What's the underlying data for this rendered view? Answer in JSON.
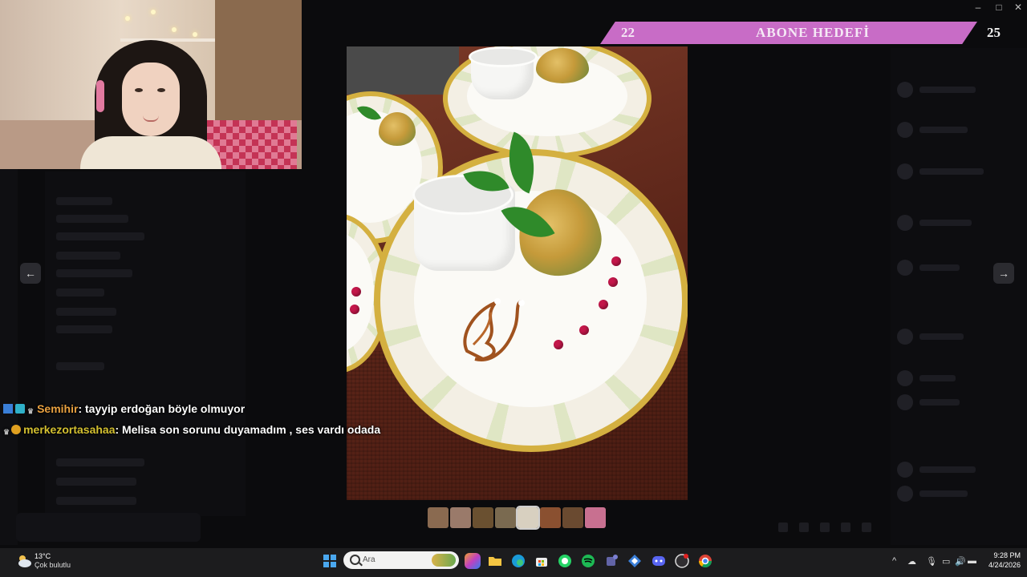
{
  "window": {
    "title": "Discord"
  },
  "goal": {
    "current": "22",
    "title": "ABONE HEDEFİ",
    "target": "25"
  },
  "chat": [
    {
      "user": "Semihir",
      "message": ": tayyip erdoğan böyle olmuyor"
    },
    {
      "user": "merkezortasahaa",
      "message": ": Melisa son sorunu duyamadım , ses vardı odada"
    }
  ],
  "viewer": {
    "prev_icon": "arrow-left-icon",
    "next_icon": "arrow-right-icon",
    "thumbnail_count": 8,
    "selected_thumbnail": 5
  },
  "taskbar": {
    "weather_temp": "13°C",
    "weather_desc": "Çok bulutlu",
    "search_placeholder": "Ara",
    "time": "9:28 PM",
    "date": "4/24/2026"
  },
  "colors": {
    "goal_bar": "#c86cc6",
    "user1": "#e8a040",
    "user2": "#d4c030",
    "pomegranate": "#c4174a"
  }
}
